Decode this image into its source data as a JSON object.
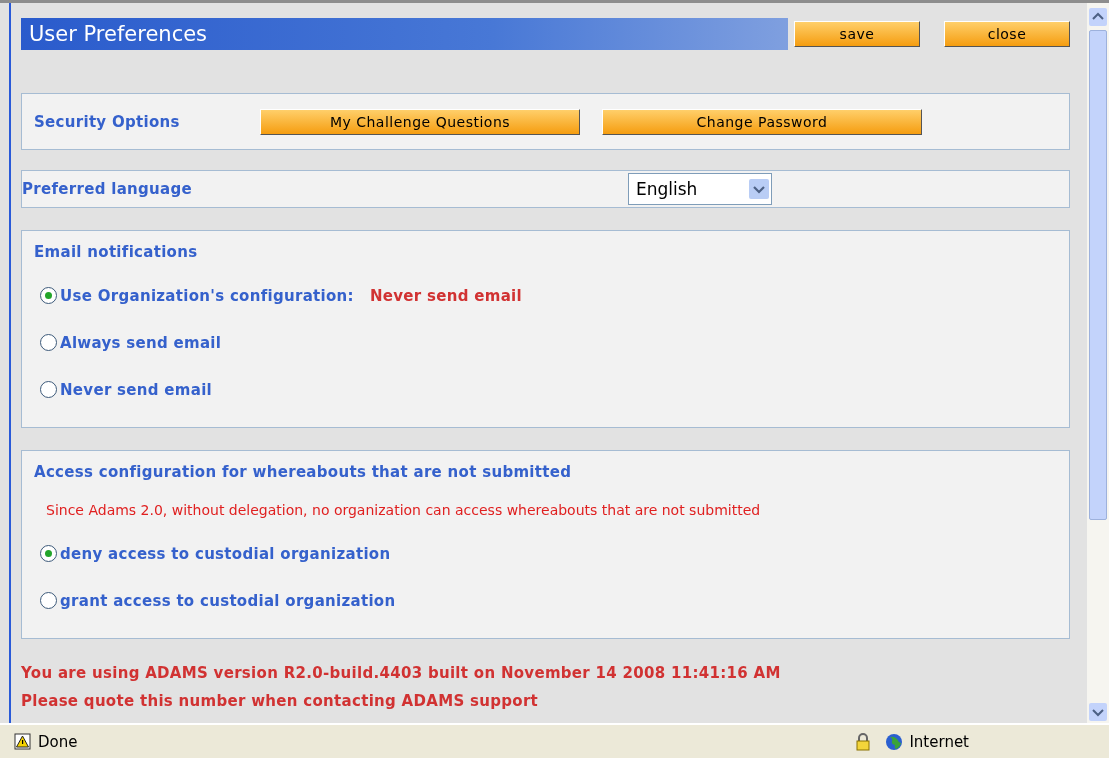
{
  "header": {
    "title": "User Preferences",
    "buttons": [
      "save",
      "close"
    ]
  },
  "security": {
    "label": "Security Options",
    "buttons": [
      "My Challenge Questions",
      "Change Password"
    ]
  },
  "language": {
    "label": "Preferred language",
    "value": "English"
  },
  "email": {
    "heading": "Email notifications",
    "options": [
      {
        "label": "Use Organization's configuration:",
        "value": "Never send email",
        "selected": true
      },
      {
        "label": "Always send email",
        "selected": false
      },
      {
        "label": "Never send email",
        "selected": false
      }
    ]
  },
  "access": {
    "heading": "Access configuration for whereabouts that are not submitted",
    "note": "Since Adams 2.0, without delegation, no organization can access whereabouts that are not submitted",
    "options": [
      {
        "label": "deny access to custodial organization",
        "selected": true
      },
      {
        "label": "grant access to custodial organization",
        "selected": false
      }
    ]
  },
  "version_lines": [
    "You are using ADAMS version R2.0-build.4403 built on November 14 2008 11:41:16 AM",
    "Please quote this number when contacting ADAMS support"
  ],
  "status_bar": {
    "status": "Done",
    "zone": "Internet"
  }
}
